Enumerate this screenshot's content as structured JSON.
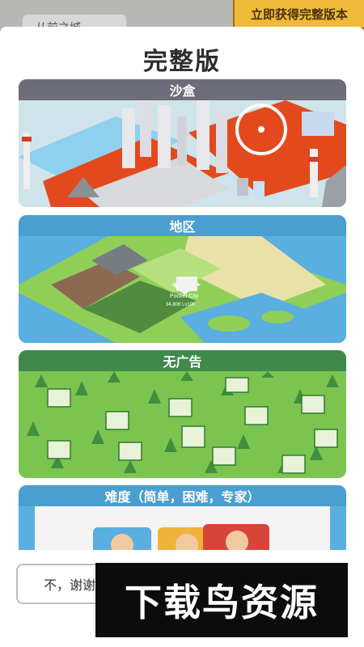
{
  "background": {
    "back_text": "从前之城"
  },
  "promo": {
    "label": "立即获得完整版本"
  },
  "modal": {
    "title": "完整版",
    "cards": [
      {
        "label": "沙盒"
      },
      {
        "label": "地区",
        "map_city_name": "Pocket City",
        "map_city_stats": "34,806  Lv100"
      },
      {
        "label": "无广告"
      },
      {
        "label": "难度（简单，困难，专家）"
      }
    ]
  },
  "footer": {
    "decline_label": "不，谢谢"
  },
  "watermark": {
    "text": "下载鸟资源"
  },
  "colors": {
    "promo_banner": "#f0b93a",
    "sandbox_header": "#6d6d7a",
    "region_header": "#4a9ed0",
    "noads_header": "#3f8a4a",
    "difficulty_header": "#4a9ed0",
    "lava": "#e24a1e",
    "water": "#5aaee0",
    "grass": "#7cc450"
  },
  "icons": [
    "city-illustration",
    "map-illustration",
    "money-stack-icon",
    "avatar-icon"
  ]
}
